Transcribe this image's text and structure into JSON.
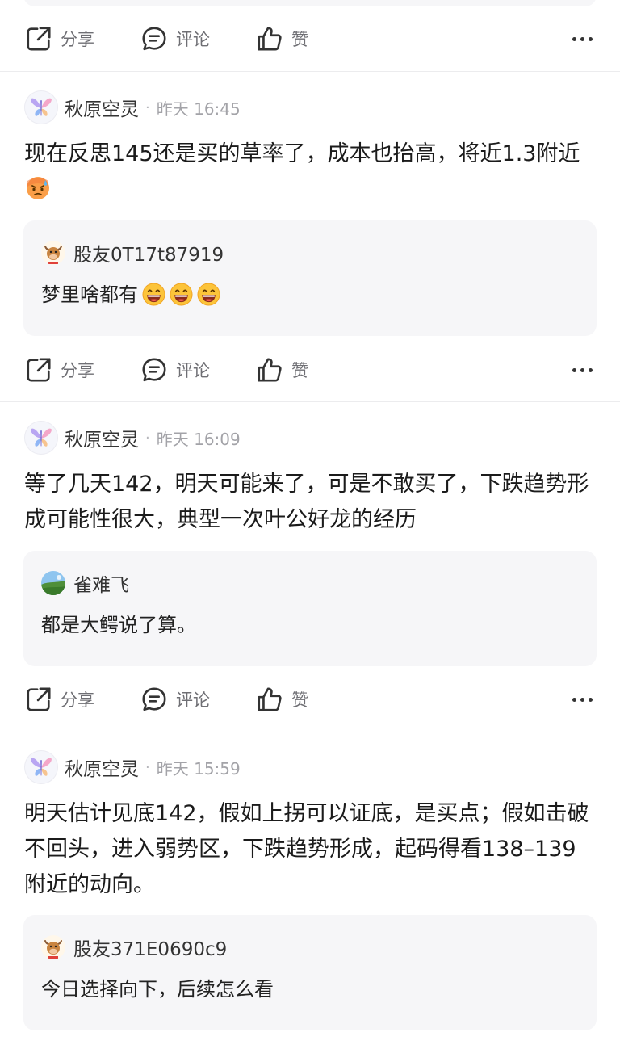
{
  "colors": {
    "icon": "#333333",
    "label": "#6f6f74",
    "reply_bg": "#f6f6f8"
  },
  "actions": {
    "share_label": "分享",
    "comment_label": "评论",
    "like_label": "赞",
    "share_icon": "share-icon",
    "comment_icon": "comment-icon",
    "like_icon": "thumbs-up-icon",
    "more_icon": "more-icon"
  },
  "posts": [
    {
      "author": "秋原空灵",
      "time": "昨天 16:45",
      "text": "现在反思145还是买的草率了，成本也抬高，将近1.3附近",
      "text_emoji": "sweating-face-emoji",
      "reply": {
        "user": "股友0T17t87919",
        "avatar": "bull-avatar",
        "text": "梦里啥都有",
        "emojis": [
          "grinning-emoji",
          "grinning-emoji",
          "grinning-emoji"
        ]
      }
    },
    {
      "author": "秋原空灵",
      "time": "昨天 16:09",
      "text": "等了几天142，明天可能来了，可是不敢买了，下跌趋势形成可能性很大，典型一次叶公好龙的经历",
      "reply": {
        "user": "雀难飞",
        "avatar": "landscape-avatar",
        "text": "都是大鳄说了算。"
      }
    },
    {
      "author": "秋原空灵",
      "time": "昨天 15:59",
      "text": "明天估计见底142，假如上拐可以证底，是买点；假如击破不回头，进入弱势区，下跌趋势形成，起码得看138–139附近的动向。",
      "reply": {
        "user": "股友371E0690c9",
        "avatar": "bull-avatar",
        "text": "今日选择向下，后续怎么看"
      }
    }
  ],
  "separator": "·"
}
